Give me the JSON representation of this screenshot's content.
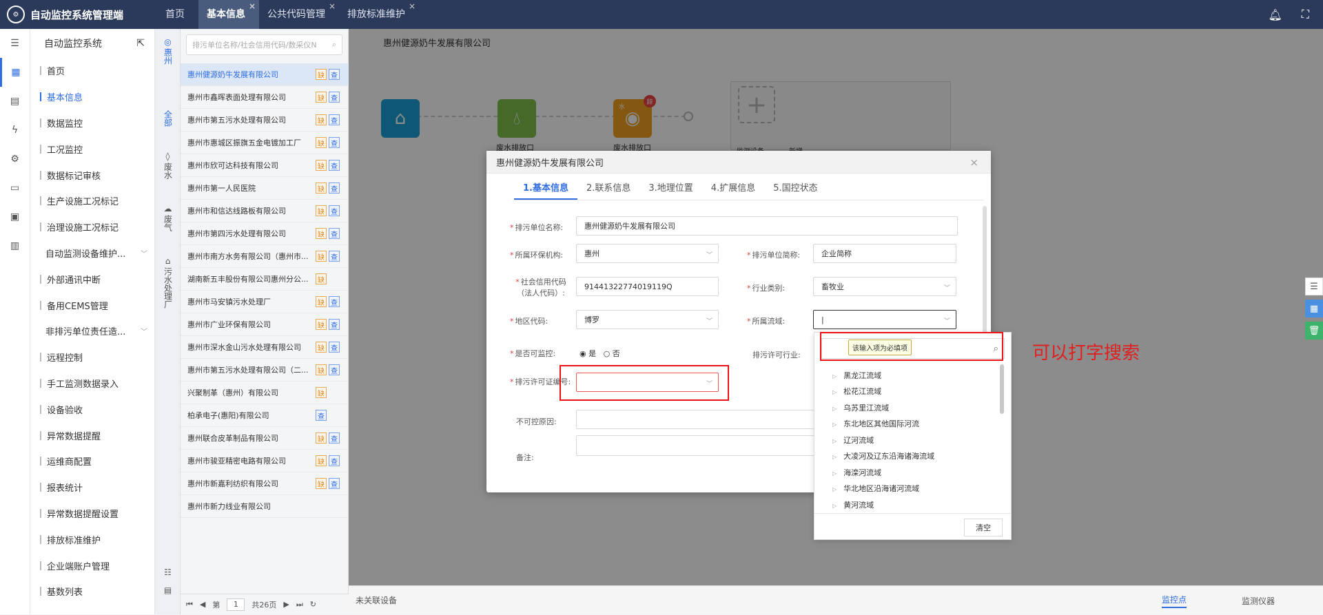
{
  "app": {
    "title": "自动监控系统管理端",
    "logo": "logo"
  },
  "tabs": [
    {
      "label": "首页"
    },
    {
      "label": "基本信息"
    },
    {
      "label": "公共代码管理"
    },
    {
      "label": "排放标准维护"
    }
  ],
  "tab_close": "×",
  "menu": {
    "title": "自动监控系统",
    "items": [
      {
        "label": "首页"
      },
      {
        "label": "基本信息"
      },
      {
        "label": "数据监控"
      },
      {
        "label": "工况监控"
      },
      {
        "label": "数据标记审核"
      },
      {
        "label": "生产设施工况标记"
      },
      {
        "label": "治理设施工况标记"
      },
      {
        "label": "自动监测设备维护..."
      },
      {
        "label": "外部通讯中断"
      },
      {
        "label": "备用CEMS管理"
      },
      {
        "label": "非排污单位责任造..."
      },
      {
        "label": "远程控制"
      },
      {
        "label": "手工监测数据录入"
      },
      {
        "label": "设备验收"
      },
      {
        "label": "异常数据提醒"
      },
      {
        "label": "运维商配置"
      },
      {
        "label": "报表统计"
      },
      {
        "label": "异常数据提醒设置"
      },
      {
        "label": "排放标准维护"
      },
      {
        "label": "企业端账户管理"
      },
      {
        "label": "基数列表"
      }
    ]
  },
  "vnav": [
    {
      "label": "惠州"
    },
    {
      "label": "全部"
    },
    {
      "label": "废水"
    },
    {
      "label": "废气"
    },
    {
      "label": "污水处理厂"
    }
  ],
  "search": {
    "placeholder": "排污单位名称/社会信用代码/数采仪N"
  },
  "enterprises": [
    {
      "name": "惠州健源奶牛发展有限公司",
      "q": "缺",
      "l": "查"
    },
    {
      "name": "惠州市鑫晖表面处理有限公司",
      "q": "缺",
      "l": "查"
    },
    {
      "name": "惠州市第五污水处理有限公司",
      "q": "缺",
      "l": "查"
    },
    {
      "name": "惠州市惠城区振旗五金电镀加工厂",
      "q": "缺",
      "l": "查"
    },
    {
      "name": "惠州市欣可达科技有限公司",
      "q": "缺",
      "l": "查"
    },
    {
      "name": "惠州市第一人民医院",
      "q": "缺",
      "l": "查"
    },
    {
      "name": "惠州市和信达线路板有限公司",
      "q": "缺",
      "l": "查"
    },
    {
      "name": "惠州市第四污水处理有限公司",
      "q": "缺",
      "l": "查"
    },
    {
      "name": "惠州市南方水务有限公司（惠州市...",
      "q": "缺",
      "l": "查"
    },
    {
      "name": "湖南新五丰股份有限公司惠州分公...",
      "q": "缺",
      "l": ""
    },
    {
      "name": "惠州市马安镇污水处理厂",
      "q": "缺",
      "l": "查"
    },
    {
      "name": "惠州市广业环保有限公司",
      "q": "缺",
      "l": "查"
    },
    {
      "name": "惠州市深水金山污水处理有限公司",
      "q": "缺",
      "l": "查"
    },
    {
      "name": "惠州市第五污水处理有限公司（二...",
      "q": "缺",
      "l": "查"
    },
    {
      "name": "兴聚制革（惠州）有限公司",
      "q": "缺",
      "l": ""
    },
    {
      "name": "柏承电子(惠阳)有限公司",
      "q": "",
      "l": "查"
    },
    {
      "name": "惠州联合皮革制品有限公司",
      "q": "缺",
      "l": "查"
    },
    {
      "name": "惠州市骏亚精密电路有限公司",
      "q": "缺",
      "l": "查"
    },
    {
      "name": "惠州市新嘉利纺织有限公司",
      "q": "缺",
      "l": "查"
    },
    {
      "name": "惠州市新力线业有限公司",
      "q": "",
      "l": ""
    }
  ],
  "pager": {
    "first": "⏮",
    "prev": "◀",
    "page_prefix": "第",
    "page": "1",
    "total": "共26页",
    "next": "▶",
    "last": "⏭",
    "refresh": "↻"
  },
  "main": {
    "title": "惠州健源奶牛发展有限公司",
    "flow_labels": [
      "废水排放口",
      "废水排放口"
    ],
    "flow_badge": "辞",
    "flow_letter": "水",
    "under_labels": [
      "监测设备",
      "新增"
    ]
  },
  "status": {
    "left": "未关联设备",
    "links": [
      "监控点",
      "监测仪器"
    ]
  },
  "modal": {
    "title": "惠州健源奶牛发展有限公司",
    "close": "×",
    "tabs": [
      "1.基本信息",
      "2.联系信息",
      "3.地理位置",
      "4.扩展信息",
      "5.国控状态"
    ],
    "fields": {
      "unit_name": {
        "label": "排污单位名称:",
        "value": "惠州健源奶牛发展有限公司"
      },
      "env_org": {
        "label": "所属环保机构:",
        "value": "惠州"
      },
      "short_name": {
        "label": "排污单位简称:",
        "value": "企业简称"
      },
      "credit_code": {
        "label1": "社会信用代码",
        "label2": "（法人代码）:",
        "value": "91441322774019119Q"
      },
      "industry": {
        "label": "行业类别:",
        "value": "畜牧业"
      },
      "region": {
        "label": "地区代码:",
        "value": "博罗"
      },
      "basin": {
        "label": "所属流域:",
        "value": ""
      },
      "monitorable": {
        "label": "是否可监控:",
        "yes": "是",
        "no": "否"
      },
      "permit_industry": {
        "label": "排污许可行业:"
      },
      "permit_no": {
        "label": "排污许可证编号:",
        "value": ""
      },
      "reason": {
        "label": "不可控原因:"
      },
      "remark": {
        "label": "备注:"
      }
    }
  },
  "dropdown": {
    "tip": "该输入项为必填项",
    "clear": "清空",
    "items": [
      "黑龙江流域",
      "松花江流域",
      "乌苏里江流域",
      "东北地区其他国际河流",
      "辽河流域",
      "大凌河及辽东沿海诸海流域",
      "海滦河流域",
      "华北地区沿海诸河流域",
      "黄河流域"
    ]
  },
  "annotation": {
    "text": "可以打字搜索",
    "color": "#e02020"
  },
  "colors": {
    "topbar": "#2b3a5b",
    "accent": "#2f6de1",
    "flow1": "#1aa0d8",
    "flow2": "#7cc04c",
    "flow3": "#f0a020"
  }
}
